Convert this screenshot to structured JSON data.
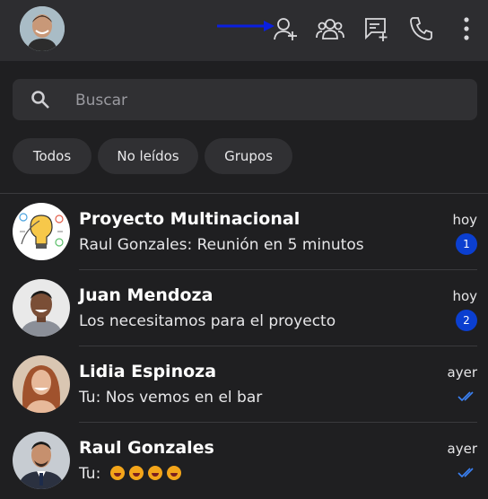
{
  "topbar": {
    "icons": [
      "add-contact-icon",
      "community-icon",
      "new-chat-icon",
      "call-icon",
      "more-vert-icon"
    ]
  },
  "search": {
    "placeholder": "Buscar",
    "value": ""
  },
  "filters": [
    {
      "label": "Todos"
    },
    {
      "label": "No leídos"
    },
    {
      "label": "Grupos"
    }
  ],
  "chats": [
    {
      "name": "Proyecto Multinacional",
      "message": "Raul Gonzales: Reunión en 5 minutos",
      "time": "hoy",
      "unread": "1"
    },
    {
      "name": "Juan Mendoza",
      "message": "Los necesitamos para el proyecto",
      "time": "hoy",
      "unread": "2"
    },
    {
      "name": "Lidia Espinoza",
      "message": "Tu: Nos vemos en el bar",
      "time": "ayer",
      "status": "read"
    },
    {
      "name": "Raul Gonzales",
      "message": "Tu:",
      "time": "ayer",
      "status": "read",
      "emojis": "😂😂😂😂"
    }
  ],
  "colors": {
    "accent": "#0b3fd0",
    "read_ticks": "#3b82f6",
    "arrow": "#0a1fe0"
  }
}
